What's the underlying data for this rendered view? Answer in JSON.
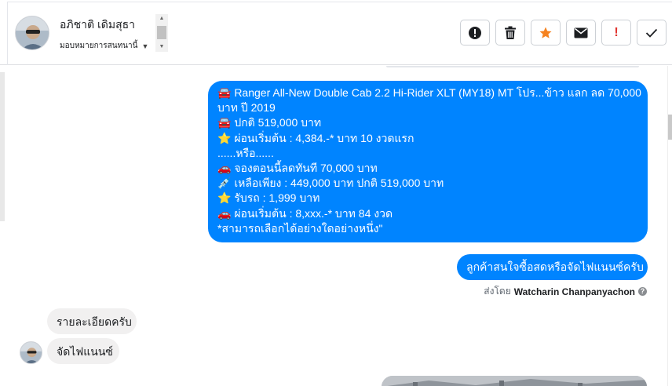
{
  "header": {
    "customer_name": "อภิชาติ เดิมสุธา",
    "assign_label": "มอบหมายการสนทนานี้",
    "actions": [
      {
        "name": "report-spam-icon",
        "glyph": "!",
        "style": "alert-circle"
      },
      {
        "name": "delete-icon",
        "glyph": "",
        "style": "trash"
      },
      {
        "name": "star-icon",
        "glyph": "★",
        "style": "star"
      },
      {
        "name": "mail-icon",
        "glyph": "",
        "style": "envelope"
      },
      {
        "name": "important-icon",
        "glyph": "!",
        "style": "red-exclaim"
      },
      {
        "name": "done-icon",
        "glyph": "",
        "style": "check"
      }
    ]
  },
  "messages": {
    "outgoing_long": [
      "🚘 Ranger All-New Double Cab 2.2 Hi-Rider XLT (MY18) MT โปร...ข้าว แลก ลด 70,000",
      "บาท ปี 2019",
      "🚘 ปกติ 519,000 บาท",
      "⭐ ผ่อนเริ่มต้น : 4,384.-* บาท 10 งวดแรก",
      "......หรือ......",
      "🚗 จองตอนนี้ลดทันที 70,000 บาท",
      "💉 เหลือเพียง : 449,000 บาท ปกติ 519,000 บาท",
      "⭐ รับรถ : 1,999 บาท",
      "🚗 ผ่อนเริ่มต้น : 8,xxx.-* บาท 84 งวด",
      "*สามารถเลือกได้อย่างใดอย่างหนึ่ง\""
    ],
    "outgoing_short": "ลูกค้าสนใจซื้อสดหรือจัดไฟแนนซ์ครับ",
    "sent_by_prefix": "ส่งโดย",
    "sent_by_name": "Watcharin Chanpanyachon",
    "incoming": [
      "รายละเอียดครับ",
      "จัดไฟแนนซ์"
    ]
  },
  "colors": {
    "outgoing_bubble": "#0084ff",
    "incoming_bubble": "#f1f0f0",
    "star": "#f5821f",
    "alert_red": "#e0322d"
  }
}
